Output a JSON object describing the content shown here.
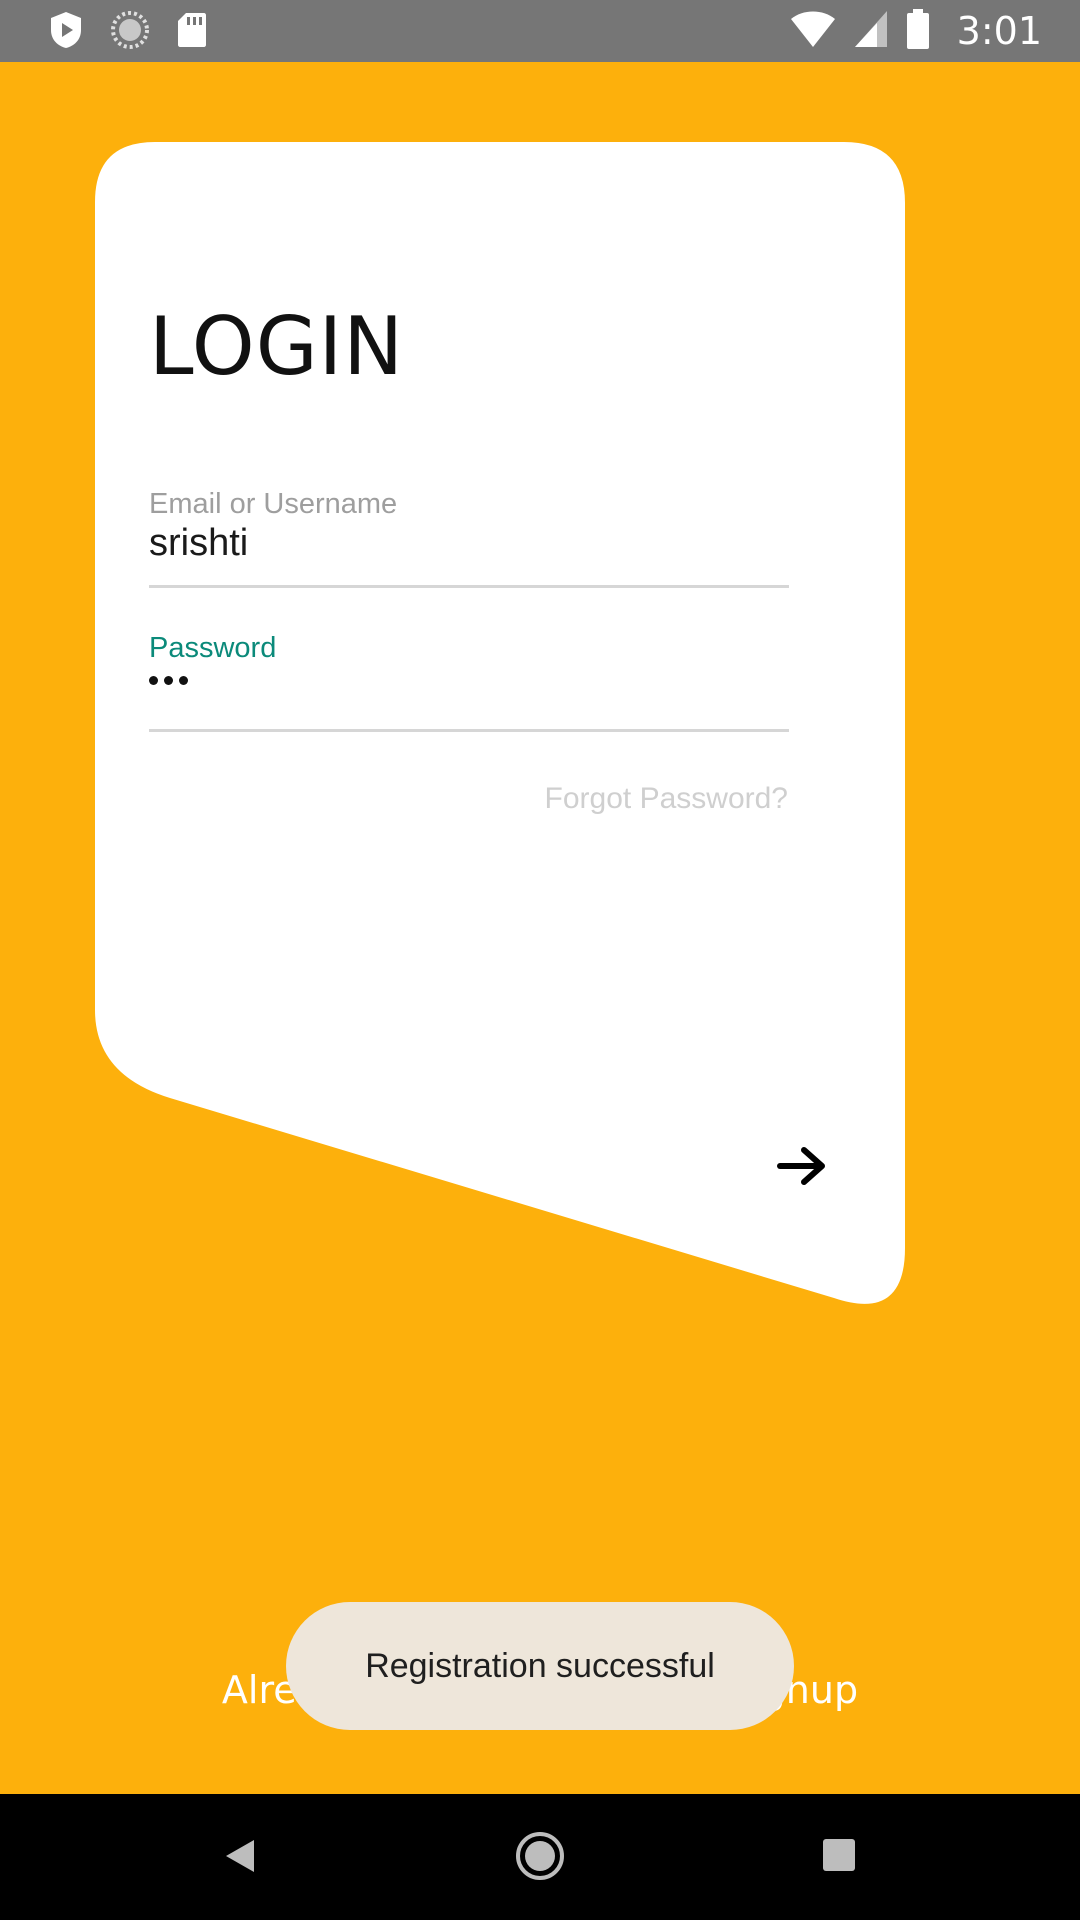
{
  "status_bar": {
    "time": "3:01",
    "icons_left": [
      "shield-play-icon",
      "sync-circle-icon",
      "sd-card-icon"
    ],
    "icons_right": [
      "wifi-icon",
      "signal-icon",
      "battery-icon"
    ]
  },
  "login": {
    "title": "LOGIN",
    "username": {
      "label": "Email or Username",
      "value": "srishti"
    },
    "password": {
      "label": "Password",
      "masked_length": 3
    },
    "forgot_password": "Forgot Password?",
    "submit_icon": "arrow-right-icon"
  },
  "footer": {
    "signup_text": "Already have an account? Signup"
  },
  "toast": {
    "message": "Registration successful"
  },
  "nav_bar": {
    "buttons": [
      "back-icon",
      "home-icon",
      "recents-icon"
    ]
  },
  "colors": {
    "background": "#FDB00C",
    "card": "#FFFFFF",
    "accent": "#0B8A7A",
    "status_bar": "#767676",
    "toast_bg": "#EEE6DA"
  }
}
